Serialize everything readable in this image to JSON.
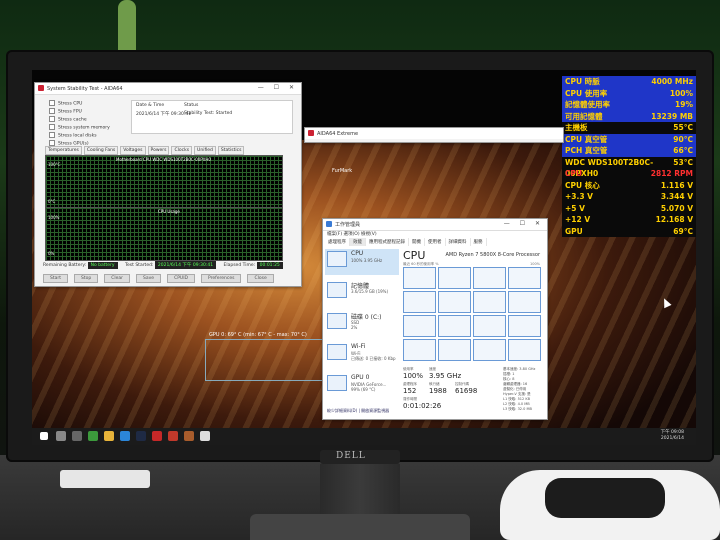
{
  "osd": {
    "rows": [
      {
        "label": "CPU 時脈",
        "value": "4000 MHz",
        "style": "blue"
      },
      {
        "label": "CPU 使用率",
        "value": "100%",
        "style": "blue"
      },
      {
        "label": "記憶體使用率",
        "value": "19%",
        "style": "blue"
      },
      {
        "label": "可用記憶體",
        "value": "13239 MB",
        "style": "blue"
      },
      {
        "label": "主機板",
        "value": "55°C",
        "style": "black"
      },
      {
        "label": "CPU 真空管",
        "value": "90°C",
        "style": "blue"
      },
      {
        "label": "PCH 真空管",
        "value": "66°C",
        "style": "blue"
      },
      {
        "label": "WDC WDS100T2B0C-00PXH0",
        "value": "53°C",
        "style": "black"
      },
      {
        "label": "CPU",
        "value": "2812 RPM",
        "style": "red"
      },
      {
        "label": "CPU 核心",
        "value": "1.116 V",
        "style": "black"
      },
      {
        "label": "+3.3 V",
        "value": "3.344 V",
        "style": "black"
      },
      {
        "label": "+5 V",
        "value": "5.070 V",
        "style": "black"
      },
      {
        "label": "+12 V",
        "value": "12.168 V",
        "style": "black"
      },
      {
        "label": "GPU",
        "value": "69°C",
        "style": "black"
      }
    ]
  },
  "stability": {
    "title": "System Stability Test - AIDA64",
    "options": [
      "Stress CPU",
      "Stress FPU",
      "Stress cache",
      "Stress system memory",
      "Stress local disks",
      "Stress GPU(s)"
    ],
    "info_headers": [
      "Date & Time",
      "Status"
    ],
    "info_date": "2021/6/14 下午 09:30:41",
    "info_status": "Stability Test: Started",
    "tabs": [
      "Temperatures",
      "Cooling Fans",
      "Voltages",
      "Powers",
      "Clocks",
      "Unified",
      "Statistics"
    ],
    "temp_legend": "Motherboard  CPU  WDC WDS100T2B0C-00PXH0",
    "temp_top": "100°C",
    "temp_bottom": "0°C",
    "usage_title": "CPU Usage",
    "usage_top": "100%",
    "usage_bottom": "0%",
    "remaining_battery_label": "Remaining Battery:",
    "remaining_battery": "No battery",
    "test_started_label": "Test Started:",
    "test_started": "2021/6/14 下午 09:30:41",
    "elapsed_label": "Elapsed Time:",
    "elapsed": "00:01:25",
    "buttons": [
      "Start",
      "Stop",
      "Clear",
      "Save",
      "CPUID",
      "Preferences",
      "Close"
    ]
  },
  "aida": {
    "title": "AIDA64 Extreme"
  },
  "furmark": {
    "fps_line": "FurMark",
    "gpu_line": "GPU 0: 69° C (min: 67° C - max: 70° C)"
  },
  "taskmgr": {
    "title": "工作管理員",
    "menu": "檔案(F)  選項(O)  檢視(V)",
    "tabs": [
      "處理程序",
      "效能",
      "應用程式歷程記錄",
      "開機",
      "使用者",
      "詳細資料",
      "服務"
    ],
    "side": [
      {
        "title": "CPU",
        "sub": "100% 3.95 GHz"
      },
      {
        "title": "記憶體",
        "sub": "3.6/15.9 GB (19%)"
      },
      {
        "title": "磁碟 0 (C:)",
        "sub": "SSD\n2%"
      },
      {
        "title": "Wi-Fi",
        "sub": "Wi-Fi\n已傳送: 0 已接收: 0 Kbp"
      },
      {
        "title": "GPU 0",
        "sub": "NVIDIA GeForce...\n99% (69 °C)"
      }
    ],
    "cpu_heading": "CPU",
    "cpu_name": "AMD Ryzen 7 5800X 8-Core Processor",
    "util_caption": "最近 60 秒的使用率 %",
    "util_max": "100%",
    "stats": {
      "util_label": "使用率",
      "util": "100%",
      "speed_label": "速度",
      "speed": "3.95 GHz",
      "proc_label": "處理程序",
      "proc": "152",
      "threads_label": "執行緒",
      "threads": "1988",
      "handles_label": "控制代碼",
      "handles": "61698",
      "uptime_label": "運作時間",
      "uptime": "0:01:02:26"
    },
    "right_info": [
      "基本速度:  3.80 GHz",
      "插槽:  1",
      "核心:  8",
      "邏輯處理器:  16",
      "虛擬化:  已停用",
      "Hyper-V 支援:  是",
      "L1 快取:  512 KB",
      "L2 快取:  4.0 MB",
      "L3 快取:  32.0 MB"
    ],
    "footer": "較少詳細資料(D)  |  開啟資源監視器"
  },
  "taskbar": {
    "time": "下午 09:08",
    "date": "2021/6/14"
  },
  "monitor": {
    "brand": "DELL"
  },
  "colors": {
    "osd_blue": "#1f36c8",
    "osd_yellow": "#ffd000",
    "osd_red": "#ff3030",
    "graph_green": "#2f6b2f"
  }
}
